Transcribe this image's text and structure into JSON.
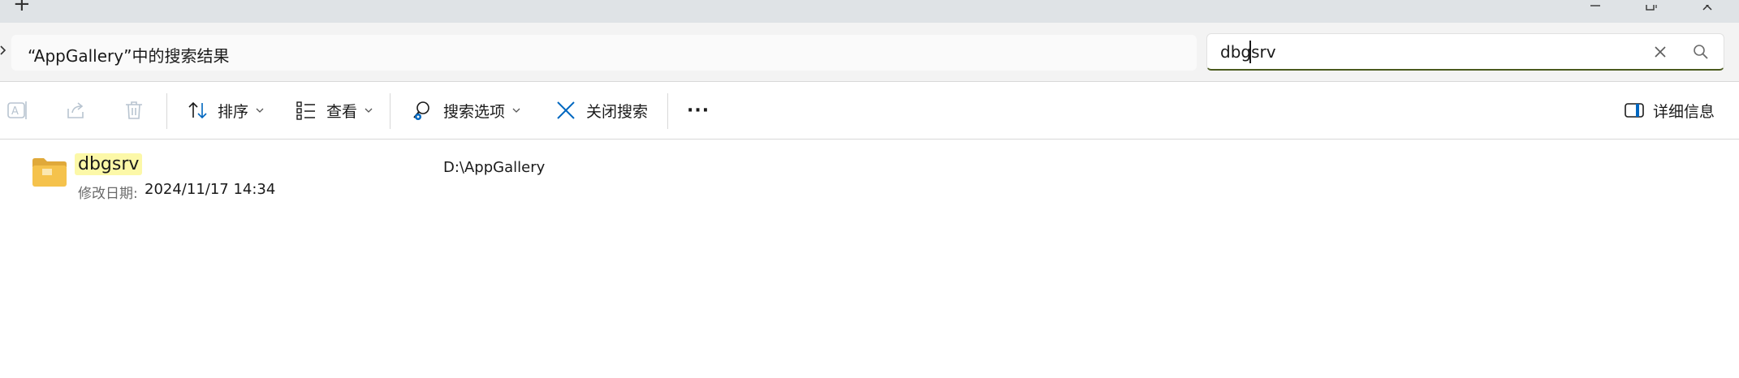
{
  "titlebar": {
    "new_tab_label": "+"
  },
  "address": {
    "text": "“AppGallery”中的搜索结果"
  },
  "search": {
    "value": "dbgsrv"
  },
  "toolbar": {
    "sort_label": "排序",
    "view_label": "查看",
    "search_options_label": "搜索选项",
    "close_search_label": "关闭搜索",
    "more_label": "···",
    "details_label": "详细信息"
  },
  "results": [
    {
      "name": "dbgsrv",
      "modified_label": "修改日期:",
      "modified_value": "2024/11/17 14:34",
      "path": "D:\\AppGallery"
    }
  ],
  "colors": {
    "titlebar_bg": "#dfe3e6",
    "accent_blue": "#0067c0",
    "highlight": "#fcf8a8",
    "folder": "#f5c24c",
    "search_underline": "#4a5a1e"
  },
  "icons": [
    "new-tab-icon",
    "minimize-icon",
    "maximize-icon",
    "close-window-icon",
    "chevron-right-icon",
    "clear-search-icon",
    "search-icon",
    "rename-icon",
    "share-icon",
    "delete-icon",
    "sort-icon",
    "view-icon",
    "search-options-icon",
    "close-search-icon",
    "details-pane-icon",
    "folder-icon"
  ]
}
